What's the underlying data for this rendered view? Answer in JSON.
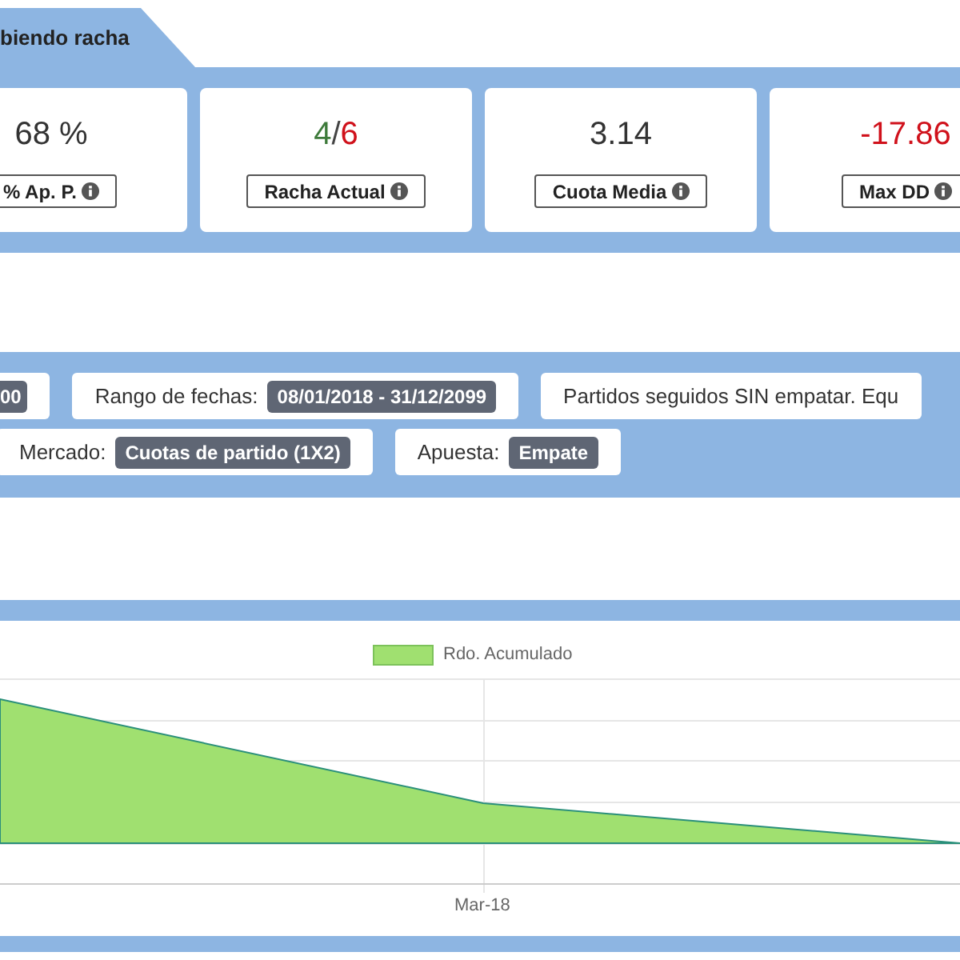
{
  "tab": {
    "label": "biendo racha"
  },
  "stats": [
    {
      "kind": "plain",
      "value": "68 %",
      "label": "% Ap. P."
    },
    {
      "kind": "ratio",
      "good": "4",
      "separator": "/",
      "bad": "6",
      "label": "Racha Actual"
    },
    {
      "kind": "plain",
      "value": "3.14",
      "label": "Cuota Media"
    },
    {
      "kind": "negative",
      "value": "-17.86",
      "label": "Max DD"
    }
  ],
  "filters": [
    [
      {
        "badge": "00"
      },
      {
        "label": "Rango de fechas:",
        "badge": "08/01/2018 - 31/12/2099"
      },
      {
        "label": "Partidos seguidos SIN empatar. Equ"
      }
    ],
    [
      {
        "label": "Mercado:",
        "badge": "Cuotas de partido (1X2)"
      },
      {
        "label": "Apuesta:",
        "badge": "Empate"
      }
    ]
  ],
  "chart": {
    "legend": "Rdo. Acumulado",
    "x_label": "Mar-18"
  }
}
